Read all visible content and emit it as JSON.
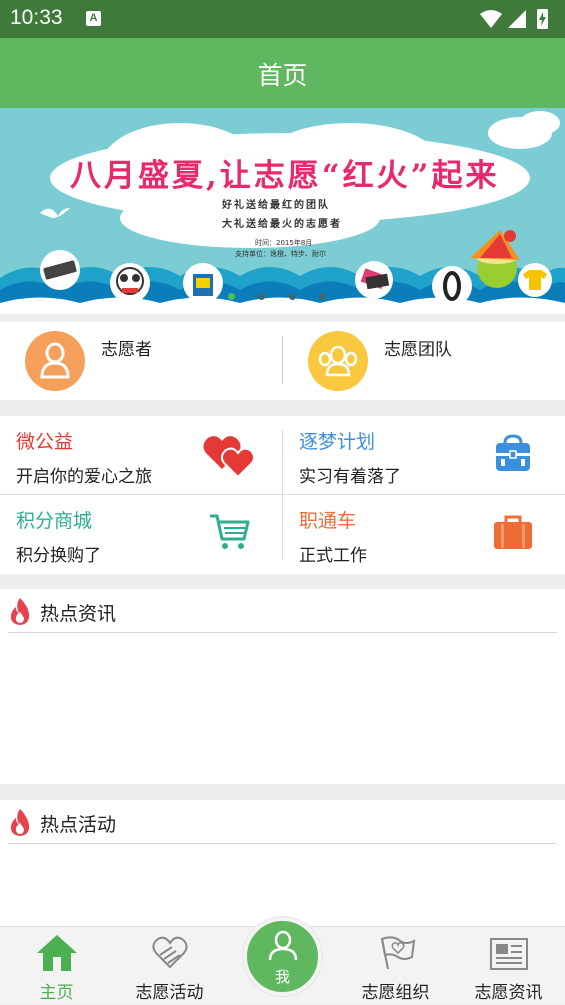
{
  "status_bar": {
    "time": "10:33",
    "notif_icon": "A"
  },
  "app_bar": {
    "title": "首页"
  },
  "banner": {
    "headline": "八月盛夏,让志愿“红火”起来",
    "line1": "好礼送给最红的团队",
    "line2": "大礼送给最火的志愿者",
    "time_text": "时间：2015年8月",
    "sponsor_text": "支持单位：逸橙、特步、耐尔",
    "carousel_pages": 4,
    "carousel_active_index": 0
  },
  "volunteer": {
    "left_label": "志愿者",
    "right_label": "志愿团队",
    "left_icon": "person-icon",
    "right_icon": "group-icon",
    "left_color": "#f5a05a",
    "right_color": "#f9c83e"
  },
  "grid": [
    {
      "title": "微公益",
      "subtitle": "开启你的爱心之旅",
      "icon": "hearts-icon",
      "color": "#e53935"
    },
    {
      "title": "逐梦计划",
      "subtitle": "实习有着落了",
      "icon": "backpack-icon",
      "color": "#3b8fe0"
    },
    {
      "title": "积分商城",
      "subtitle": "积分换购了",
      "icon": "cart-icon",
      "color": "#2daf8f"
    },
    {
      "title": "职通车",
      "subtitle": "正式工作",
      "icon": "briefcase-icon",
      "color": "#ef6c35"
    }
  ],
  "sections": {
    "news_title": "热点资讯",
    "activity_title": "热点活动"
  },
  "tabs": [
    {
      "label": "主页",
      "icon": "home-icon",
      "active": true
    },
    {
      "label": "志愿活动",
      "icon": "hand-heart-icon",
      "active": false
    },
    {
      "label": "我",
      "icon": "person-icon",
      "active": false
    },
    {
      "label": "志愿组织",
      "icon": "flag-icon",
      "active": false
    },
    {
      "label": "志愿资讯",
      "icon": "newspaper-icon",
      "active": false
    }
  ],
  "colors": {
    "primary": "#5fb860",
    "status_bar": "#3f7a3a",
    "active_tab": "#4caf50"
  }
}
